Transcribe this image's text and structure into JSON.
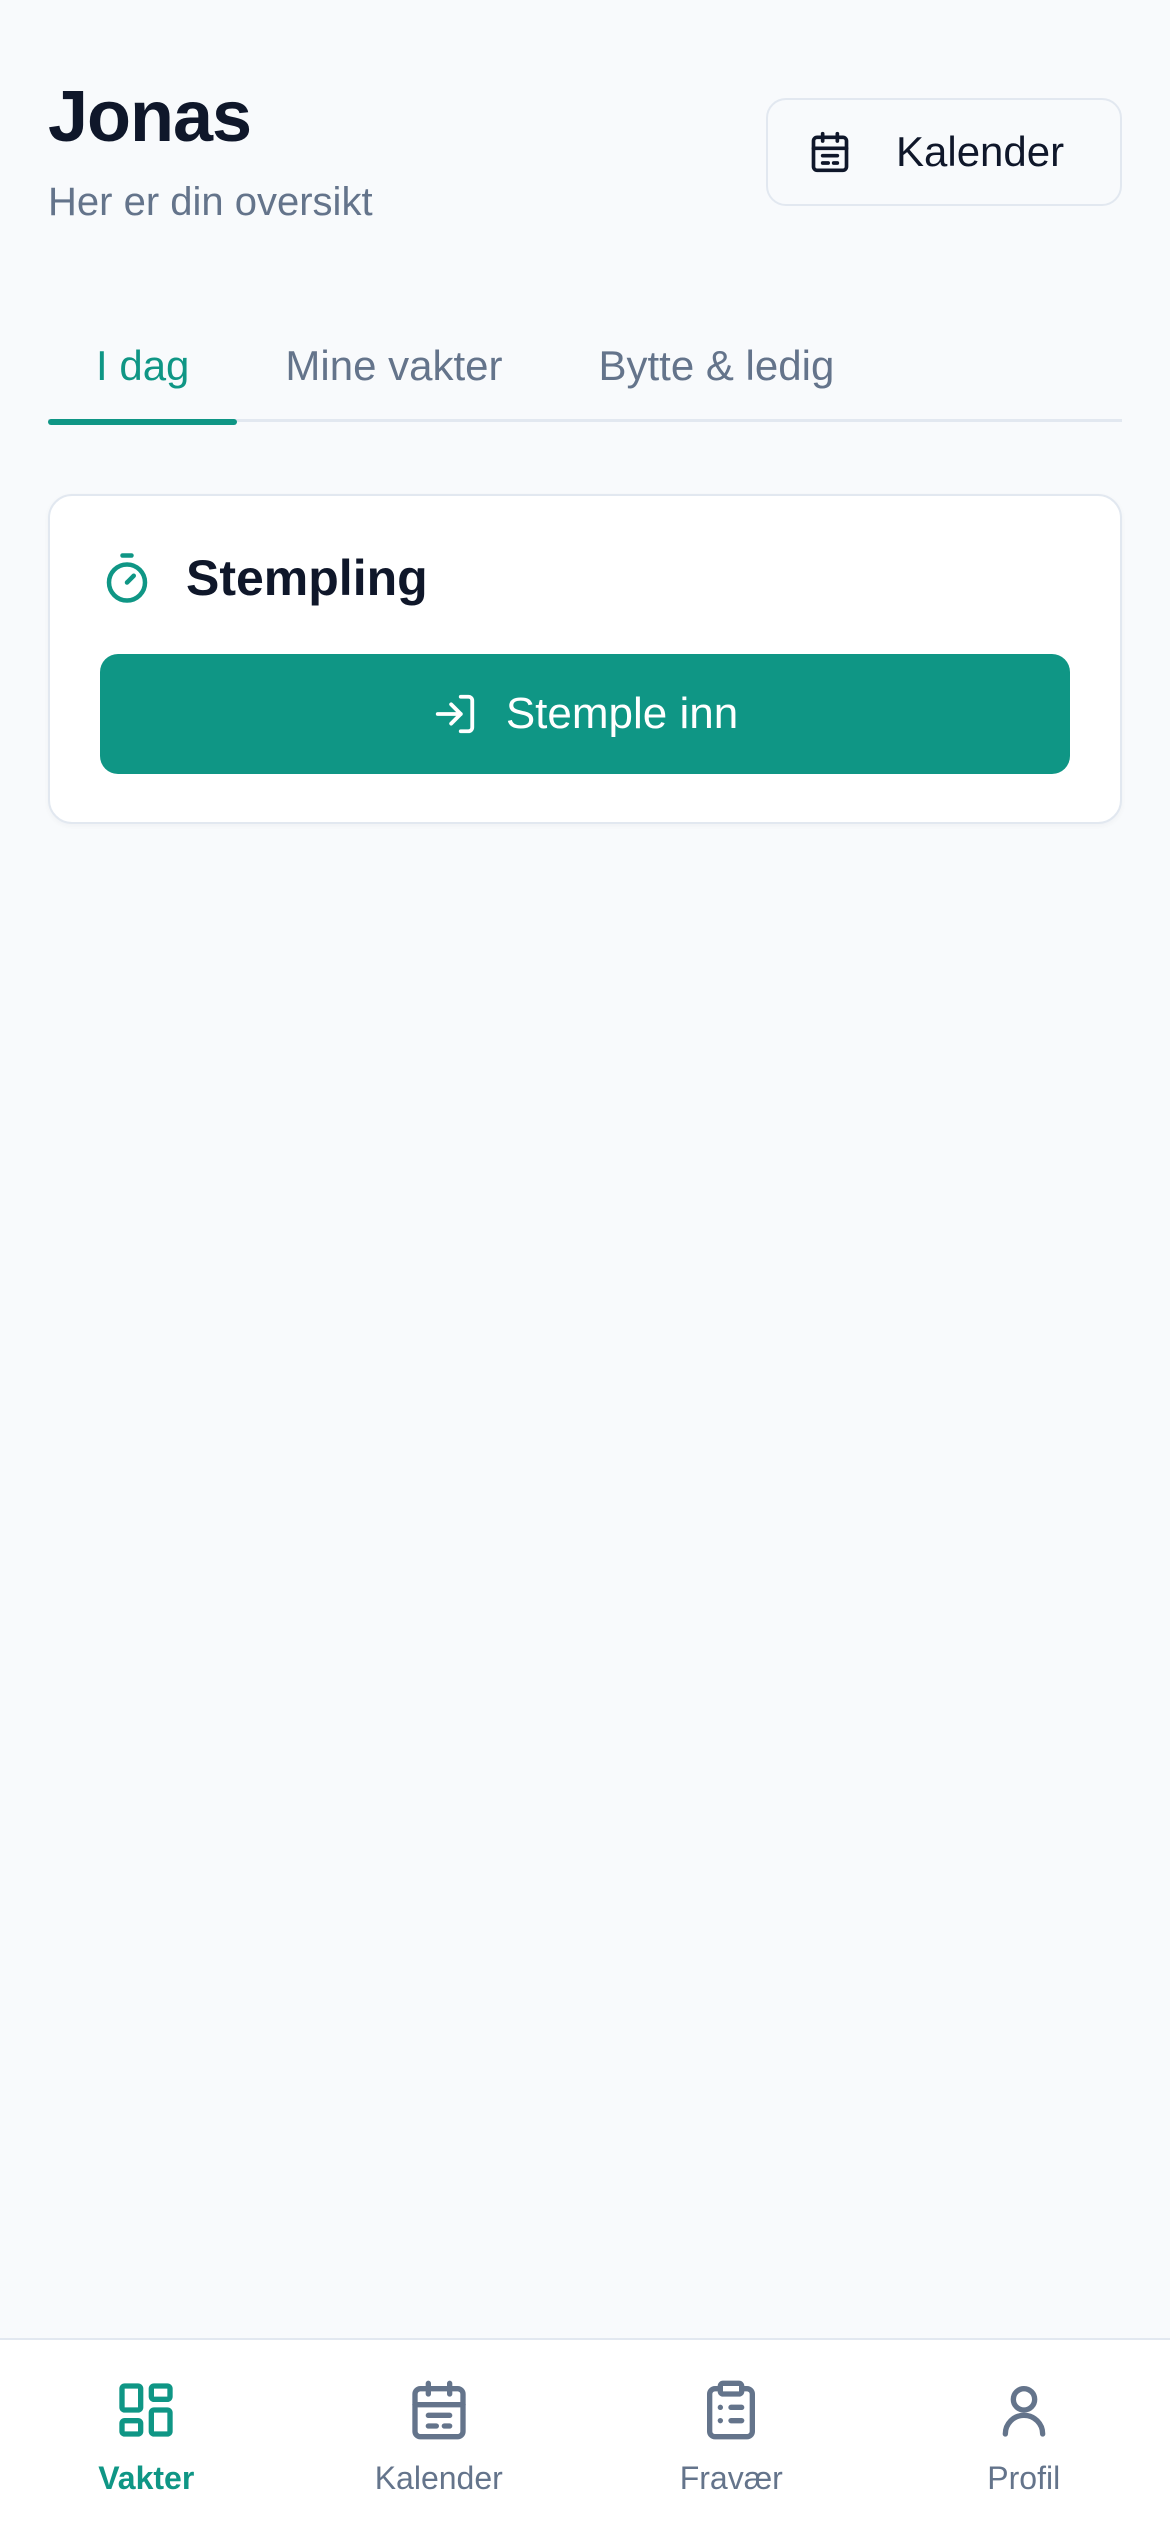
{
  "header": {
    "user_name": "Jonas",
    "subtitle": "Her er din oversikt",
    "calendar_button": {
      "label": "Kalender",
      "icon": "calendar-icon"
    }
  },
  "tabs": [
    {
      "label": "I dag",
      "active": true
    },
    {
      "label": "Mine vakter",
      "active": false
    },
    {
      "label": "Bytte & ledig",
      "active": false
    }
  ],
  "stamping_card": {
    "icon": "stopwatch-icon",
    "title": "Stempling",
    "button": {
      "label": "Stemple inn",
      "icon": "log-in-icon"
    }
  },
  "bottom_nav": [
    {
      "label": "Vakter",
      "icon": "layout-grid-icon",
      "active": true
    },
    {
      "label": "Kalender",
      "icon": "calendar-icon",
      "active": false
    },
    {
      "label": "Fravær",
      "icon": "clipboard-list-icon",
      "active": false
    },
    {
      "label": "Profil",
      "icon": "user-icon",
      "active": false
    }
  ],
  "colors": {
    "accent": "#0f9685",
    "text_primary": "#0f172a",
    "text_muted": "#64748b",
    "border": "#e2e8f0",
    "background": "#f8fafc"
  }
}
